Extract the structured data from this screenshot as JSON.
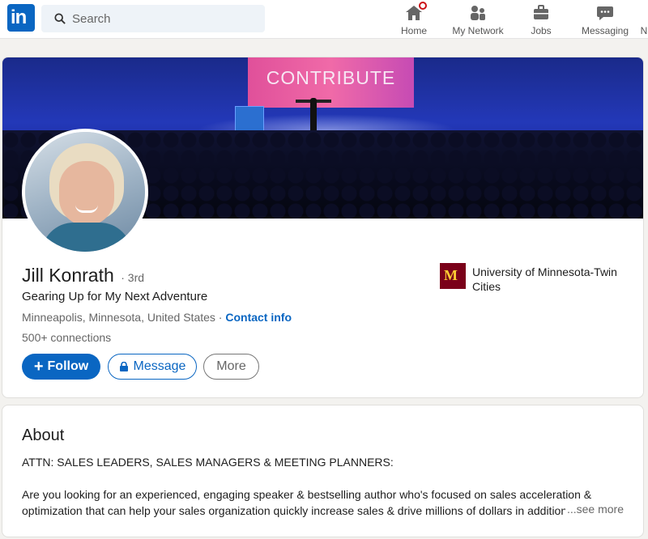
{
  "nav": {
    "logo_text": "in",
    "search_placeholder": "Search",
    "items": [
      {
        "label": "Home",
        "icon": "home-icon"
      },
      {
        "label": "My Network",
        "icon": "network-icon"
      },
      {
        "label": "Jobs",
        "icon": "briefcase-icon"
      },
      {
        "label": "Messaging",
        "icon": "chat-icon"
      },
      {
        "label": "N",
        "icon": "bell-icon"
      }
    ]
  },
  "banner": {
    "screen_text": "CONTRIBUTE"
  },
  "profile": {
    "name": "Jill Konrath",
    "degree": "· 3rd",
    "headline": "Gearing Up for My Next Adventure",
    "location": "Minneapolis, Minnesota, United States · ",
    "contact_info": "Contact info",
    "connections": "500+ connections",
    "school": "University of Minnesota-Twin Cities",
    "school_logo_text": "M"
  },
  "actions": {
    "follow": "Follow",
    "follow_plus": "+",
    "message": "Message",
    "more": "More"
  },
  "about": {
    "title": "About",
    "line1": "ATTN: SALES LEADERS, SALES MANAGERS & MEETING PLANNERS:",
    "paragraph": "Are you looking for an experienced, engaging speaker & bestselling author who's focused on sales acceleration & optimization that can help your sales organization quickly increase sales & drive millions of dollars in additiona",
    "see_more": "...see more"
  },
  "colors": {
    "brand": "#0a66c2",
    "notification": "#cc1016",
    "school": "#7a0019"
  }
}
